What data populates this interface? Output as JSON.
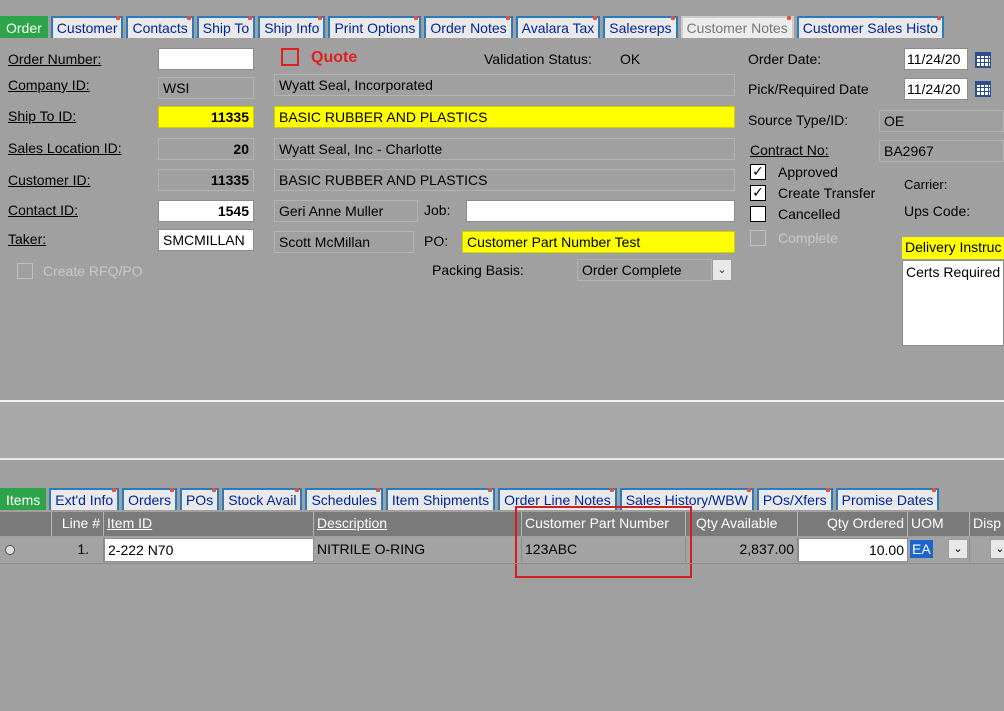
{
  "top_tabs": [
    {
      "label": "Order",
      "state": "active"
    },
    {
      "label": "Customer",
      "state": "normal"
    },
    {
      "label": "Contacts",
      "state": "normal"
    },
    {
      "label": "Ship To",
      "state": "normal"
    },
    {
      "label": "Ship Info",
      "state": "normal"
    },
    {
      "label": "Print Options",
      "state": "normal"
    },
    {
      "label": "Order Notes",
      "state": "normal"
    },
    {
      "label": "Avalara Tax",
      "state": "normal"
    },
    {
      "label": "Salesreps",
      "state": "normal"
    },
    {
      "label": "Customer Notes",
      "state": "disabled"
    },
    {
      "label": "Customer Sales Histo",
      "state": "normal"
    }
  ],
  "header": {
    "order_number": {
      "label": "Order Number:",
      "value": ""
    },
    "company_id": {
      "label": "Company ID:",
      "value": "WSI",
      "name": "Wyatt Seal, Incorporated"
    },
    "ship_to_id": {
      "label": "Ship To ID:",
      "value": "11335",
      "name": "BASIC RUBBER AND PLASTICS"
    },
    "sales_location_id": {
      "label": "Sales Location ID:",
      "value": "20",
      "name": "Wyatt Seal, Inc - Charlotte"
    },
    "customer_id": {
      "label": "Customer ID:",
      "value": "11335",
      "name": "BASIC RUBBER AND PLASTICS"
    },
    "contact_id": {
      "label": "Contact ID:",
      "value": "1545",
      "name": "Geri Anne Muller"
    },
    "job": {
      "label": "Job:",
      "value": ""
    },
    "taker": {
      "label": "Taker:",
      "value": "SMCMILLAN",
      "name": "Scott McMillan"
    },
    "po": {
      "label": "PO:",
      "value": "Customer Part Number Test"
    },
    "quote_label": "Quote",
    "validation_status": {
      "label": "Validation Status:",
      "value": "OK"
    },
    "packing_basis": {
      "label": "Packing Basis:",
      "value": "Order Complete"
    },
    "create_rfq_label": "Create RFQ/PO"
  },
  "right_panel": {
    "order_date": {
      "label": "Order Date:",
      "value": "11/24/20"
    },
    "pick_date": {
      "label": "Pick/Required Date",
      "value": "11/24/20"
    },
    "source_type": {
      "label": "Source Type/ID:",
      "value": "OE"
    },
    "contract_no": {
      "label": "Contract No:",
      "value": "BA2967"
    },
    "approved": {
      "label": "Approved",
      "checked": true
    },
    "create_transfer": {
      "label": "Create Transfer",
      "checked": true
    },
    "cancelled": {
      "label": "Cancelled",
      "checked": false
    },
    "complete": {
      "label": "Complete",
      "checked": false
    },
    "carrier_label": "Carrier:",
    "ups_code_label": "Ups Code:",
    "delivery_instructions_label": "Delivery Instruc",
    "delivery_instructions_text": "Certs Required"
  },
  "bottom_tabs": [
    {
      "label": "Items",
      "state": "active"
    },
    {
      "label": "Ext'd Info",
      "state": "normal"
    },
    {
      "label": "Orders",
      "state": "normal"
    },
    {
      "label": "POs",
      "state": "normal"
    },
    {
      "label": "Stock Avail",
      "state": "normal"
    },
    {
      "label": "Schedules",
      "state": "normal"
    },
    {
      "label": "Item Shipments",
      "state": "normal"
    },
    {
      "label": "Order Line Notes",
      "state": "normal"
    },
    {
      "label": "Sales History/WBW",
      "state": "normal"
    },
    {
      "label": "POs/Xfers",
      "state": "normal"
    },
    {
      "label": "Promise Dates",
      "state": "normal"
    }
  ],
  "grid": {
    "columns": [
      "Line #",
      "Item ID",
      "Description",
      "Customer Part Number",
      "Qty Available",
      "Qty Ordered",
      "UOM",
      "Disp"
    ],
    "rows": [
      {
        "line": "1.",
        "item_id": "2-222 N70",
        "description": "NITRILE O-RING",
        "customer_part_number": "123ABC",
        "qty_available": "2,837.00",
        "qty_ordered": "10.00",
        "uom": "EA"
      }
    ]
  },
  "colors": {
    "background": "#a0a0a0",
    "active_tab": "#2da44a",
    "highlight": "#ffff00",
    "quote_red": "#e02020",
    "callout_red": "#d22020"
  }
}
